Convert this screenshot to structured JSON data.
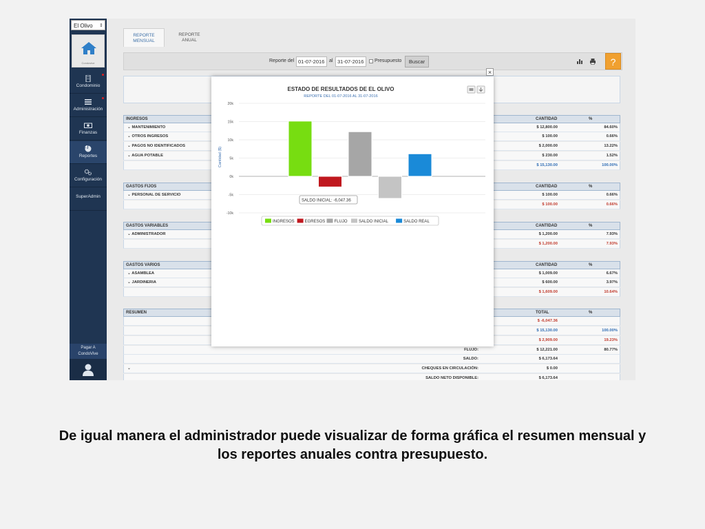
{
  "sidebar": {
    "org_select": "El Olivo",
    "home_label": "Condovive",
    "items": [
      {
        "label": "Condominio",
        "icon": "building-icon",
        "has_alert": true
      },
      {
        "label": "Administración",
        "icon": "list-icon",
        "has_alert": true
      },
      {
        "label": "Finanzas",
        "icon": "money-icon",
        "has_alert": false
      },
      {
        "label": "Reportes",
        "icon": "pie-chart-icon",
        "has_alert": false,
        "active": true
      },
      {
        "label": "Configuración",
        "icon": "gears-icon",
        "has_alert": false
      },
      {
        "label": "SuperAdmin",
        "icon": "",
        "has_alert": false
      }
    ],
    "pay_line1": "Pagar A",
    "pay_line2": "CondoVive"
  },
  "tabs": [
    {
      "line1": "REPORTE",
      "line2": "MENSUAL",
      "active": true
    },
    {
      "line1": "REPORTE",
      "line2": "ANUAL",
      "active": false
    }
  ],
  "toolbar": {
    "reporte_del": "Reporte del",
    "date_from": "01-07-2016",
    "al": "al",
    "date_to": "31-07-2016",
    "presupuesto": "Presupuesto",
    "buscar": "Buscar",
    "help": "?"
  },
  "sections": {
    "ingresos": {
      "header": "INGRESOS",
      "col_amount": "CANTIDAD",
      "col_pct": "%",
      "rows": [
        {
          "label": "MANTENIMIENTO",
          "amount": "$ 12,800.00",
          "pct": "84.60%"
        },
        {
          "label": "OTROS INGRESOS",
          "amount": "$ 100.00",
          "pct": "0.66%"
        },
        {
          "label": "PAGOS NO IDENTIFICADOS",
          "amount": "$ 2,000.00",
          "pct": "13.22%"
        },
        {
          "label": "AGUA POTABLE",
          "amount": "$ 230.00",
          "pct": "1.52%"
        }
      ],
      "total_amount": "$ 15,130.00",
      "total_pct": "100.00%"
    },
    "gastos_fijos": {
      "header": "GASTOS FIJOS",
      "col_amount": "CANTIDAD",
      "col_pct": "%",
      "rows": [
        {
          "label": "PERSONAL DE SERVICIO",
          "amount": "$ 100.00",
          "pct": "0.66%"
        }
      ],
      "total_amount": "$ 100.00",
      "total_pct": "0.66%"
    },
    "gastos_variables": {
      "header": "GASTOS VARIABLES",
      "col_amount": "CANTIDAD",
      "col_pct": "%",
      "rows": [
        {
          "label": "ADMINISTRADOR",
          "amount": "$ 1,200.00",
          "pct": "7.93%"
        }
      ],
      "total_amount": "$ 1,200.00",
      "total_pct": "7.93%"
    },
    "gastos_varios": {
      "header": "GASTOS VARIOS",
      "col_amount": "CANTIDAD",
      "col_pct": "%",
      "rows": [
        {
          "label": "ASAMBLEA",
          "amount": "$ 1,009.00",
          "pct": "6.67%"
        },
        {
          "label": "JARDINERIA",
          "amount": "$ 600.00",
          "pct": "3.97%"
        }
      ],
      "total_amount": "$ 1,609.00",
      "total_pct": "10.64%"
    },
    "resumen": {
      "header": "RESUMEN",
      "col_amount": "TOTAL",
      "col_pct": "%",
      "rows": [
        {
          "label": "",
          "amount": "$ -6,047.36",
          "pct": "",
          "style": "red"
        },
        {
          "label": "",
          "amount": "$ 15,130.00",
          "pct": "100.00%",
          "style": "blue"
        },
        {
          "label": "",
          "amount": "$ 2,909.00",
          "pct": "19.23%",
          "style": "red"
        },
        {
          "label": "FLUJO:",
          "amount": "$ 12,221.00",
          "pct": "80.77%",
          "style": "plain"
        },
        {
          "label": "SALDO:",
          "amount": "$ 6,173.64",
          "pct": "",
          "style": "plain"
        },
        {
          "label": "CHEQUES EN CIRCULACIÓN:",
          "amount": "$ 0.00",
          "pct": "",
          "style": "plain"
        },
        {
          "label": "SALDO NETO DISPONIBLE:",
          "amount": "$ 6,173.64",
          "pct": "",
          "style": "plain"
        }
      ]
    }
  },
  "modal": {
    "close": "×",
    "tooltip": "SALDO INICIAL: -6,047.36"
  },
  "chart_data": {
    "type": "bar",
    "title": "ESTADO DE RESULTADOS DE EL OLIVO",
    "subtitle": "REPORTE DEL 01-07-2016 AL 31-07-2016",
    "ylabel": "Cantidad ($)",
    "ylim": [
      -10000,
      20000
    ],
    "yticks": [
      20000,
      15000,
      10000,
      5000,
      0,
      -5000,
      -10000
    ],
    "ytick_labels": [
      "20k",
      "15k",
      "10k",
      "5k",
      "0k",
      "-5k",
      "-10k"
    ],
    "grid": true,
    "legend_position": "bottom",
    "series": [
      {
        "name": "INGRESOS",
        "value": 15130,
        "color": "#77dd11"
      },
      {
        "name": "EGRESOS",
        "value": -2909,
        "color": "#c0181f"
      },
      {
        "name": "FLUJO",
        "value": 12221,
        "color": "#a6a6a6"
      },
      {
        "name": "SALDO INICIAL",
        "value": -6047.36,
        "color": "#c4c4c4"
      },
      {
        "name": "SALDO REAL",
        "value": 6173.64,
        "color": "#1a8ad8"
      }
    ]
  },
  "caption": {
    "line1": "De igual manera el administrador puede visualizar de forma gráfica el resumen mensual y",
    "line2": "los reportes anuales contra presupuesto."
  }
}
